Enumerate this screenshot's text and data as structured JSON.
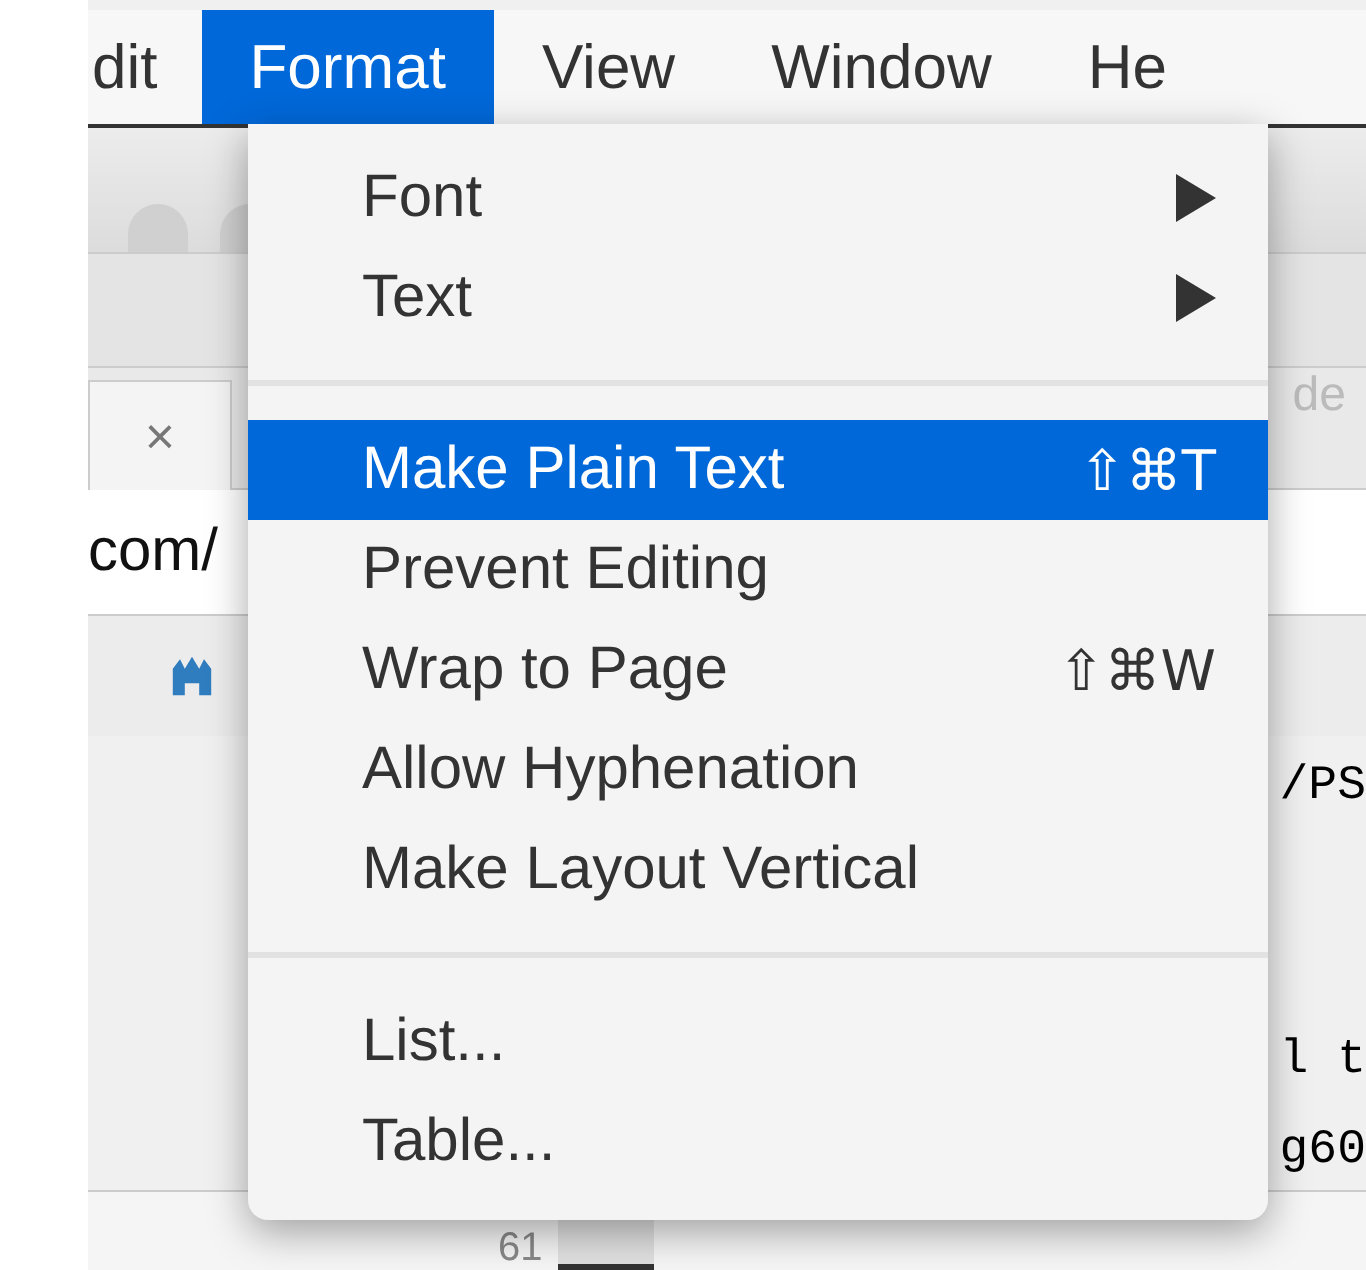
{
  "menu_bar": [
    {
      "label": "dit",
      "selected": false
    },
    {
      "label": "Format",
      "selected": true
    },
    {
      "label": "View",
      "selected": false
    },
    {
      "label": "Window",
      "selected": false
    },
    {
      "label": "He",
      "selected": false
    }
  ],
  "menu": [
    {
      "kind": "item",
      "label": "Font",
      "submenu": true,
      "selected": false
    },
    {
      "kind": "item",
      "label": "Text",
      "submenu": true,
      "selected": false
    },
    {
      "kind": "separator"
    },
    {
      "kind": "item",
      "label": "Make Plain Text",
      "shortcut": "⇧⌘T",
      "submenu": false,
      "selected": true
    },
    {
      "kind": "item",
      "label": "Prevent Editing",
      "submenu": false,
      "selected": false
    },
    {
      "kind": "item",
      "label": "Wrap to Page",
      "shortcut": "⇧⌘W",
      "submenu": false,
      "selected": false
    },
    {
      "kind": "item",
      "label": "Allow Hyphenation",
      "submenu": false,
      "selected": false
    },
    {
      "kind": "item",
      "label": "Make Layout Vertical",
      "submenu": false,
      "selected": false
    },
    {
      "kind": "separator"
    },
    {
      "kind": "item",
      "label": "List...",
      "submenu": false,
      "selected": false
    },
    {
      "kind": "item",
      "label": "Table...",
      "submenu": false,
      "selected": false
    }
  ],
  "background": {
    "tab_close": "×",
    "address": "com/",
    "hidden_label": "de",
    "code_lines": [
      "/PS",
      "l t",
      "g60"
    ],
    "line_number": "61"
  }
}
